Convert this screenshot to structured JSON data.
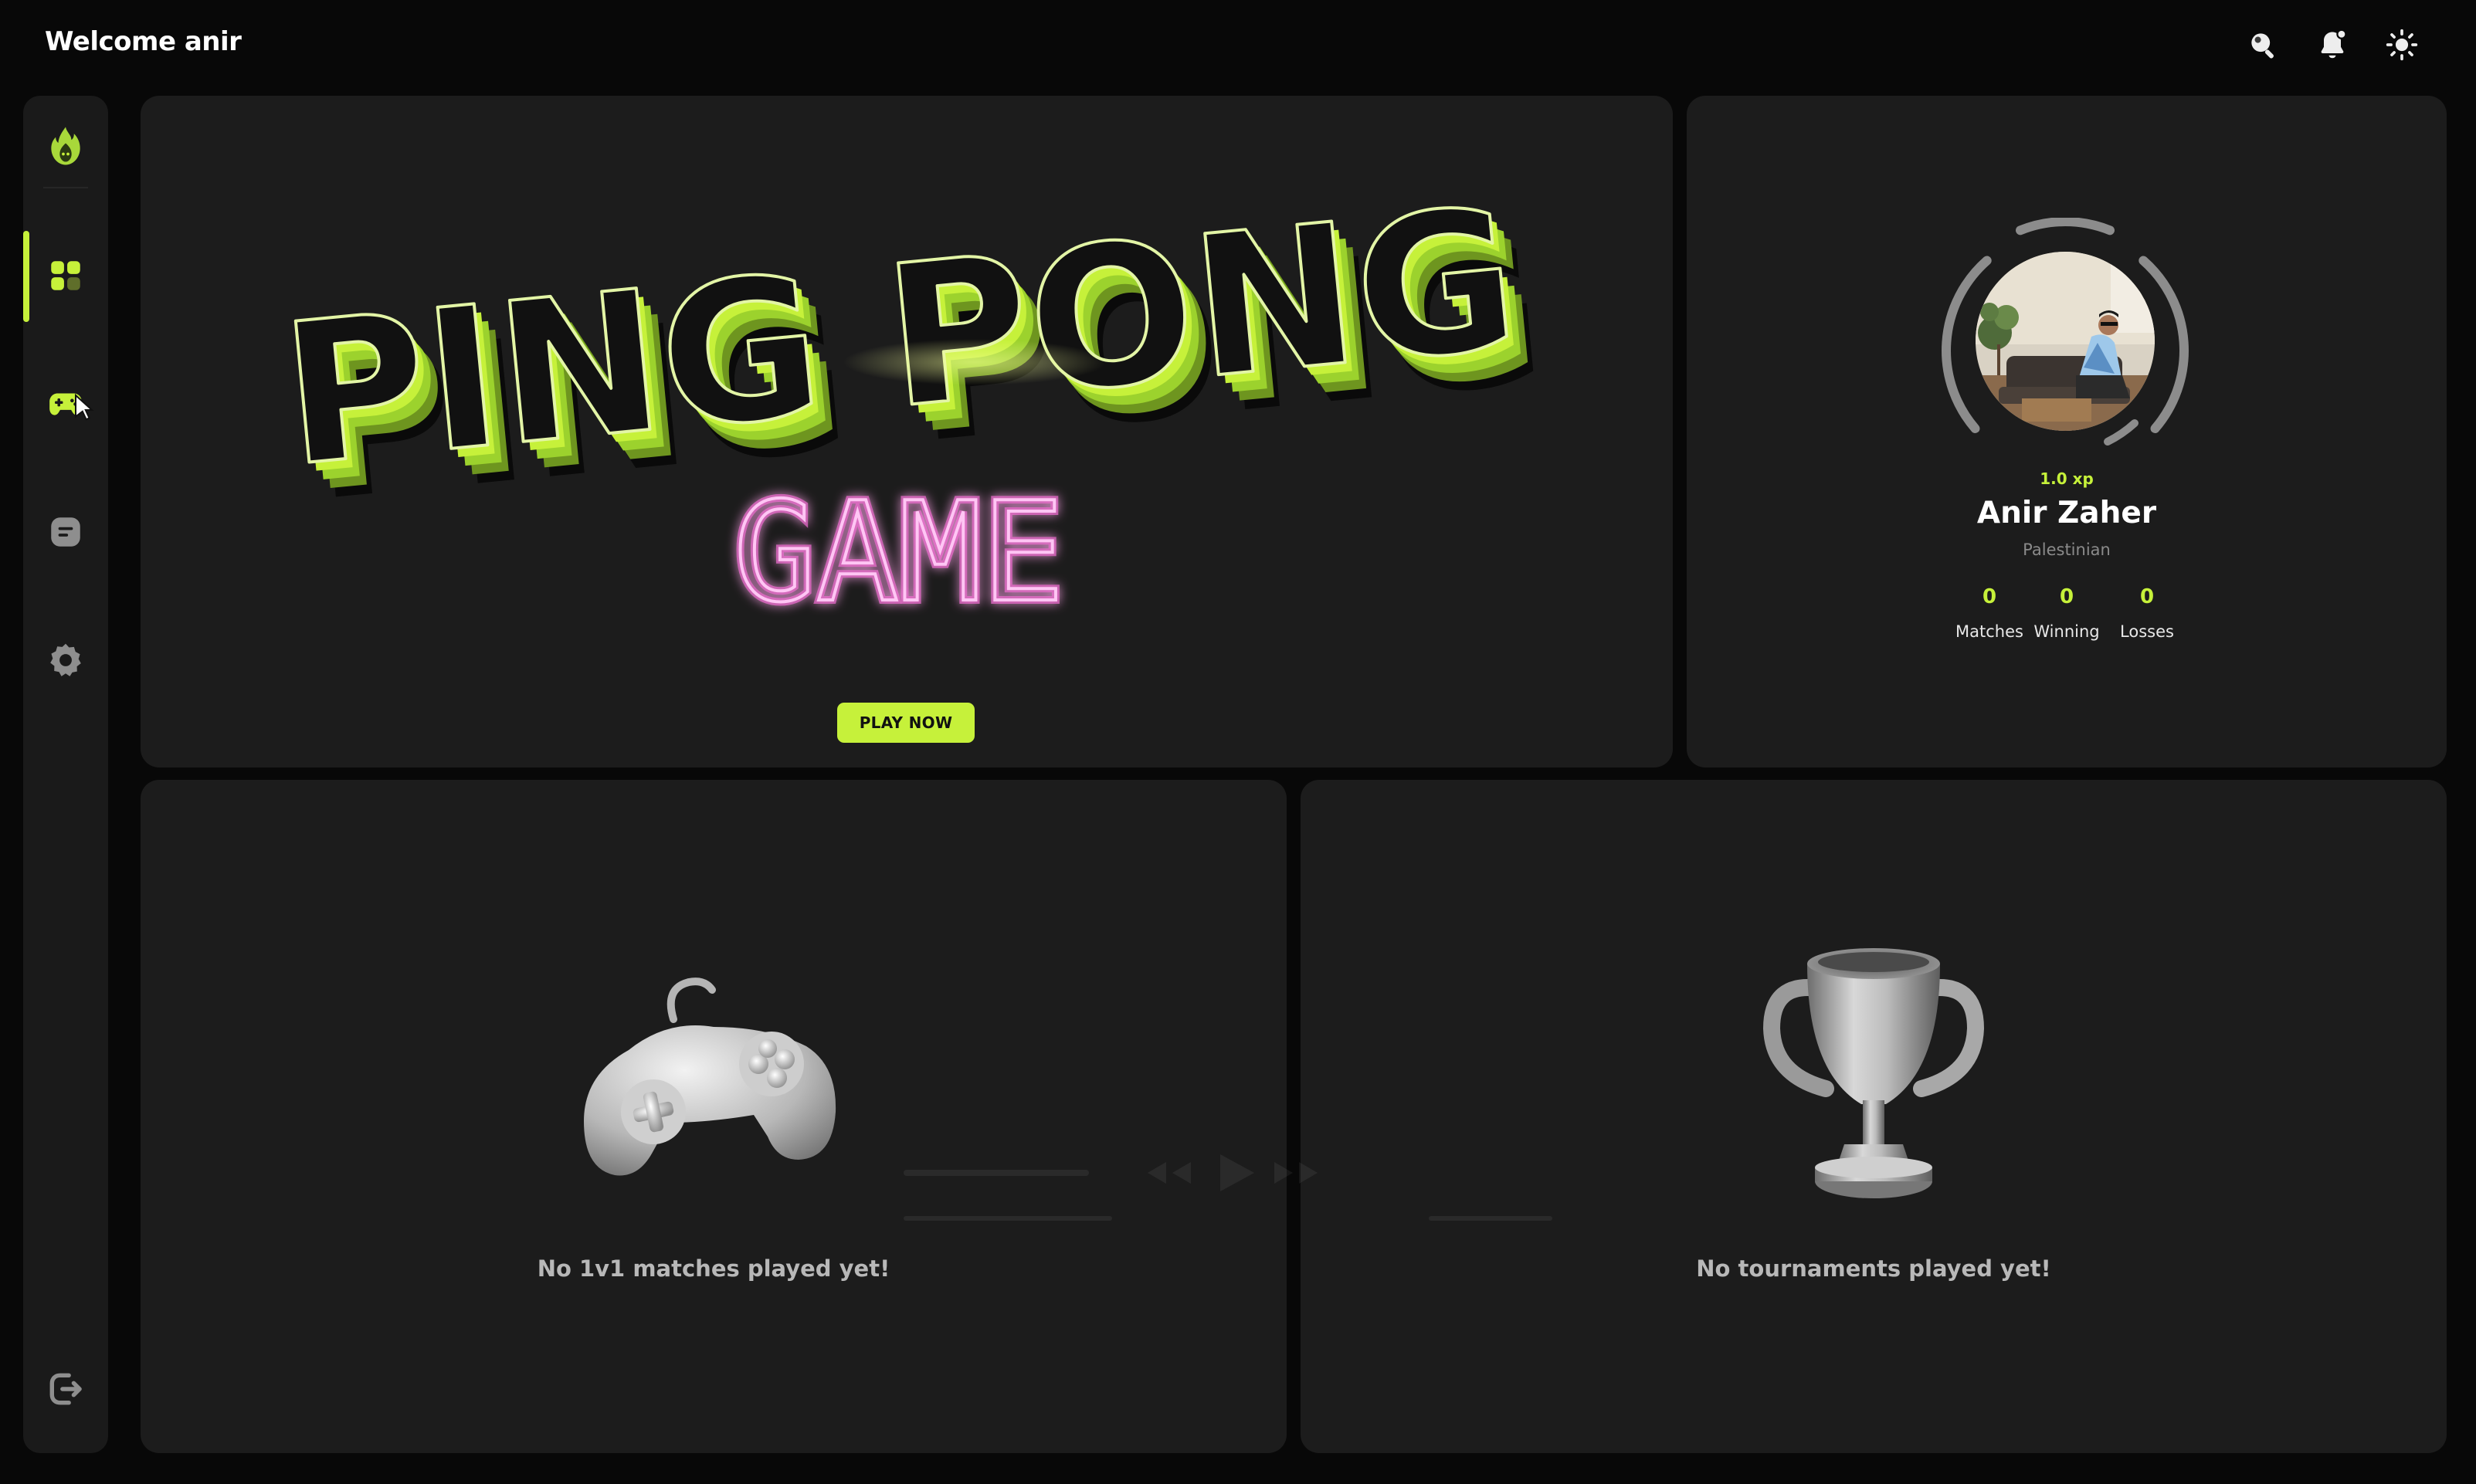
{
  "header": {
    "welcome": "Welcome anir",
    "icons": [
      "search-icon",
      "bell-icon",
      "sun-icon"
    ]
  },
  "sidebar": {
    "logo": "flame-logo",
    "items": [
      {
        "name": "dashboard",
        "icon": "grid-icon",
        "active": true
      },
      {
        "name": "game",
        "icon": "gamepad-icon",
        "active": false
      },
      {
        "name": "chat",
        "icon": "chat-icon",
        "active": false
      },
      {
        "name": "settings",
        "icon": "gear-icon",
        "active": false
      }
    ],
    "bottom": {
      "name": "logout",
      "icon": "logout-icon"
    }
  },
  "hero": {
    "title_top": "PING PONG",
    "title_bottom": "GAME",
    "play_button": "PLAY NOW"
  },
  "profile": {
    "xp": "1.0 xp",
    "name": "Anir Zaher",
    "nationality": "Palestinian",
    "stats": [
      {
        "value": "0",
        "label": "Matches"
      },
      {
        "value": "0",
        "label": "Winning"
      },
      {
        "value": "0",
        "label": "Losses"
      }
    ]
  },
  "matches": {
    "empty_text": "No 1v1 matches played yet!",
    "icon": "gamepad-3d-icon"
  },
  "tournaments": {
    "empty_text": "No tournaments played yet!",
    "icon": "trophy-3d-icon"
  },
  "colors": {
    "accent": "#c6f13a",
    "card": "#1c1c1c",
    "background": "#080808",
    "neon_pink": "#f06ad0"
  }
}
